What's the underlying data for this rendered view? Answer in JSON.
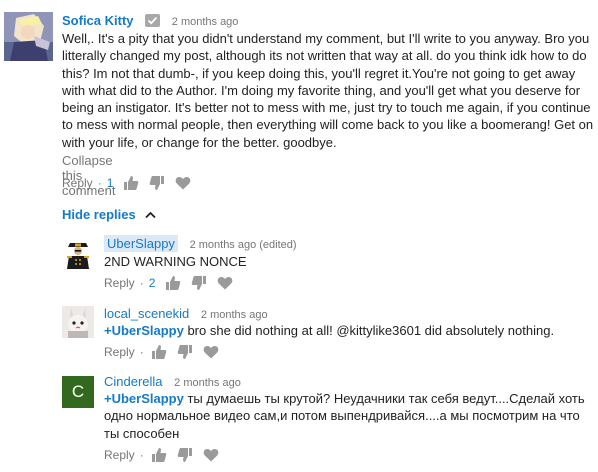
{
  "comments": [
    {
      "author": "Sofica Kitty",
      "time": "2 months ago",
      "text": "Well,. It's a pity that you didn't understand my comment, but I'll write to you anyway. Bro you litterally changed my post, although its not written that way at all. do you think idk how to do this? Im not that dumb-, if you keep doing this, you'll regret it.You're not going to get away with what did to the Author. I'm doing my favorite thing, and you'll get what you deserve for being an instigator. It's better not to mess with me, just try to touch me again, if you continue to mess with normal people, then everything will come back to you like a boomerang! Get on with your life, or change for the better. goodbye.",
      "collapse_label": "Collapse this comment",
      "reply_label": "Reply",
      "likes": "1"
    }
  ],
  "hide_replies_label": "Hide replies",
  "replies": [
    {
      "author": "UberSlappy",
      "time": "2 months ago (edited)",
      "text": "2ND WARNING NONCE",
      "reply_label": "Reply",
      "likes": "2"
    },
    {
      "author": "local_scenekid",
      "time": "2 months ago",
      "mention": "+UberSlappy",
      "text": " bro she did nothing at all! @kittylike3601 did absolutely nothing.",
      "reply_label": "Reply"
    },
    {
      "author": "Cinderella",
      "avatar_letter": "C",
      "time": "2 months ago",
      "mention": "+UberSlappy",
      "text": " ты думаешь ты крутой? Неудачники так себя ведут....Сделай хоть одно нормальное видео сам,и потом выпендривайся....а мы посмотрим на что ты способен",
      "reply_label": "Reply"
    }
  ],
  "colors": {
    "link": "#167ac6",
    "muted": "#767676",
    "text": "#222222",
    "avatar_green": "#33691e"
  }
}
